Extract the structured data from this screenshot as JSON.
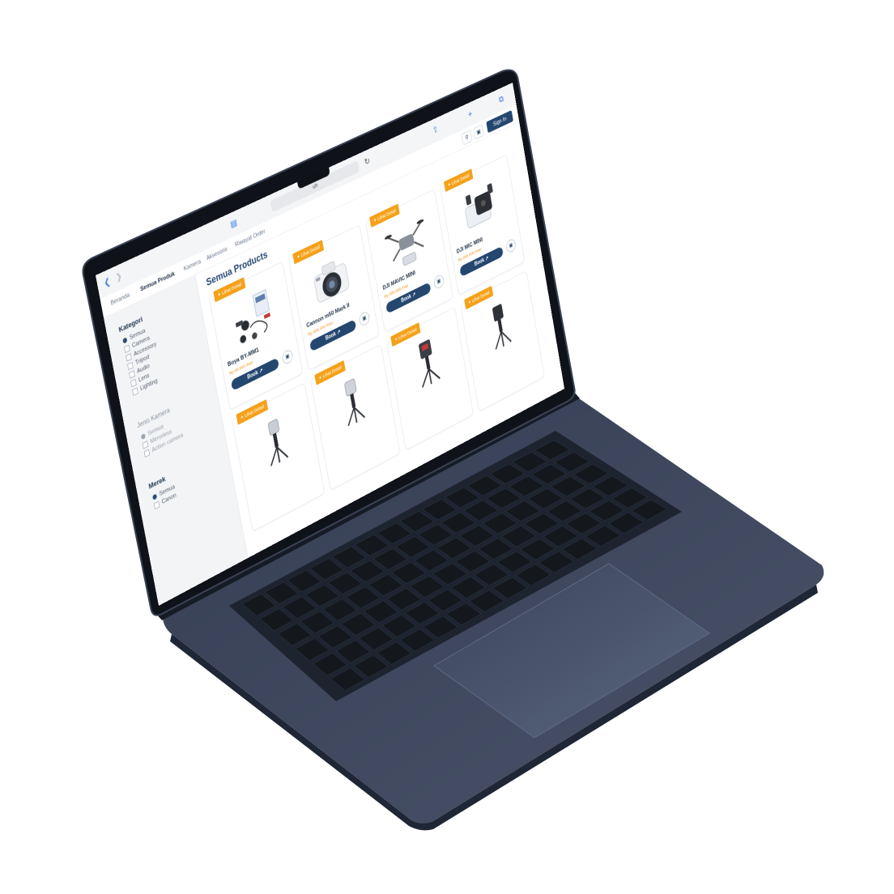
{
  "browser": {
    "url": "uh",
    "icons": [
      "back-icon",
      "forward-icon",
      "sidebar-icon",
      "reload-icon",
      "share-icon",
      "new-tab-icon",
      "tabs-icon"
    ]
  },
  "nav": {
    "links": [
      "Beranda",
      "Semua Produk",
      "Kamera",
      "Aksesoris",
      "Riwayat Order"
    ],
    "active": "Semua Produk",
    "signin_label": "Sign In"
  },
  "sidebar": {
    "kategori": {
      "title": "Kategori",
      "options": [
        "Semua",
        "Camera",
        "Accessory",
        "Tripod",
        "Audio",
        "Lens",
        "Lighting"
      ],
      "selected": "Semua"
    },
    "jenis_kamera": {
      "title": "Jenis Kamera",
      "options": [
        "Semua",
        "Mirrorless",
        "Action camera"
      ],
      "selected": "Semua"
    },
    "merek": {
      "title": "Merek",
      "options": [
        "Semua",
        "Canon"
      ],
      "selected": "Semua"
    }
  },
  "main": {
    "title": "Semua Products",
    "products": [
      {
        "badge": "Lihat Detail",
        "name": "Boya BY-MM1",
        "price": "Rp 00.000 /hari",
        "icon": "accessory-kit-icon"
      },
      {
        "badge": "Lihat Detail",
        "name": "Cannon m50 Mark II",
        "price": "Rp 000.000 /hari",
        "icon": "camera-icon"
      },
      {
        "badge": "Lihat Detail",
        "name": "DJI MAVIC MINI",
        "price": "Rp 000.000 /hari",
        "icon": "drone-icon"
      },
      {
        "badge": "Lihat Detail",
        "name": "DJI MIC MINI",
        "price": "Rp 000.000 /hari",
        "icon": "microphone-kit-icon"
      },
      {
        "badge": "Lihat Detail",
        "name": "",
        "price": "",
        "icon": "gimbal-icon"
      },
      {
        "badge": "Lihat Detail",
        "name": "",
        "price": "",
        "icon": "gimbal-icon"
      },
      {
        "badge": "Lihat Detail",
        "name": "",
        "price": "",
        "icon": "gimbal-icon"
      },
      {
        "badge": "Lihat Detail",
        "name": "",
        "price": "",
        "icon": "gimbal-icon"
      }
    ],
    "book_label": "Book"
  },
  "colors": {
    "badge": "#f5a11a",
    "primary": "#24476f",
    "price": "#f08c00",
    "chassis": "#2c3447",
    "keys": "#14171c"
  }
}
